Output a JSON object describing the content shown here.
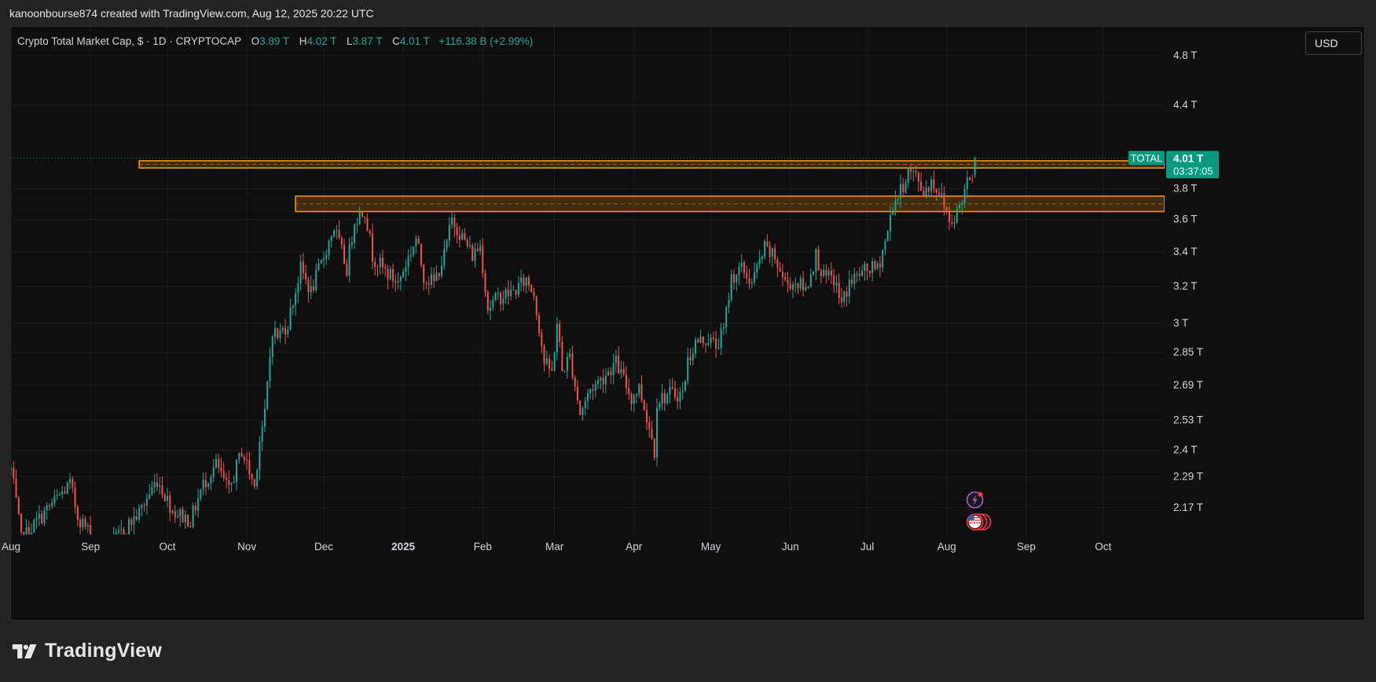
{
  "header": {
    "attribution": "kanoonbourse874 created with TradingView.com, Aug 12, 2025 20:22 UTC"
  },
  "legend": {
    "symbol": "Crypto Total Market Cap, $ · 1D · CRYPTOCAP",
    "o_key": "O",
    "o_val": "3.89 T",
    "h_key": "H",
    "h_val": "4.02 T",
    "l_key": "L",
    "l_val": "3.87 T",
    "c_key": "C",
    "c_val": "4.01 T",
    "change": "+116.38 B (+2.99%)"
  },
  "currency_button": "USD",
  "footer": {
    "brand": "TradingView"
  },
  "colors": {
    "up": "#26a69a",
    "down": "#ef5350",
    "zone": "#f7931a",
    "background": "#0f0f0f",
    "grid": "#1f1f1f",
    "price_tag": "#089981"
  },
  "chart_data": {
    "type": "candlestick",
    "series_name": "TOTAL",
    "scale": "log",
    "ylim": [
      2.07,
      5.05
    ],
    "xlim": [
      "2024-08-01",
      "2025-10-25"
    ],
    "y_ticks": [
      {
        "v": 4.8,
        "label": "4.8 T"
      },
      {
        "v": 4.4,
        "label": "4.4 T"
      },
      {
        "v": 3.8,
        "label": "3.8 T"
      },
      {
        "v": 3.6,
        "label": "3.6 T"
      },
      {
        "v": 3.4,
        "label": "3.4 T"
      },
      {
        "v": 3.2,
        "label": "3.2 T"
      },
      {
        "v": 3.0,
        "label": "3 T"
      },
      {
        "v": 2.85,
        "label": "2.85 T"
      },
      {
        "v": 2.69,
        "label": "2.69 T"
      },
      {
        "v": 2.53,
        "label": "2.53 T"
      },
      {
        "v": 2.4,
        "label": "2.4 T"
      },
      {
        "v": 2.29,
        "label": "2.29 T"
      },
      {
        "v": 2.17,
        "label": "2.17 T"
      }
    ],
    "x_ticks": [
      {
        "t": "2024-08-01",
        "label": "Aug"
      },
      {
        "t": "2024-09-01",
        "label": "Sep"
      },
      {
        "t": "2024-10-01",
        "label": "Oct"
      },
      {
        "t": "2024-11-01",
        "label": "Nov"
      },
      {
        "t": "2024-12-01",
        "label": "Dec"
      },
      {
        "t": "2025-01-01",
        "label": "2025",
        "bold": true
      },
      {
        "t": "2025-02-01",
        "label": "Feb"
      },
      {
        "t": "2025-03-01",
        "label": "Mar"
      },
      {
        "t": "2025-04-01",
        "label": "Apr"
      },
      {
        "t": "2025-05-01",
        "label": "May"
      },
      {
        "t": "2025-06-01",
        "label": "Jun"
      },
      {
        "t": "2025-07-01",
        "label": "Jul"
      },
      {
        "t": "2025-08-01",
        "label": "Aug"
      },
      {
        "t": "2025-09-01",
        "label": "Sep"
      },
      {
        "t": "2025-10-01",
        "label": "Oct"
      }
    ],
    "anchors": [
      [
        "2024-08-01",
        2.32
      ],
      [
        "2024-08-05",
        2.05
      ],
      [
        "2024-08-14",
        2.15
      ],
      [
        "2024-08-24",
        2.26
      ],
      [
        "2024-08-27",
        2.14
      ],
      [
        "2024-09-06",
        2.0
      ],
      [
        "2024-09-20",
        2.15
      ],
      [
        "2024-09-27",
        2.28
      ],
      [
        "2024-10-03",
        2.16
      ],
      [
        "2024-10-10",
        2.12
      ],
      [
        "2024-10-15",
        2.26
      ],
      [
        "2024-10-20",
        2.34
      ],
      [
        "2024-10-25",
        2.23
      ],
      [
        "2024-10-30",
        2.4
      ],
      [
        "2024-11-04",
        2.25
      ],
      [
        "2024-11-06",
        2.45
      ],
      [
        "2024-11-08",
        2.55
      ],
      [
        "2024-11-11",
        2.97
      ],
      [
        "2024-11-13",
        2.93
      ],
      [
        "2024-11-17",
        3.0
      ],
      [
        "2024-11-22",
        3.3
      ],
      [
        "2024-11-26",
        3.17
      ],
      [
        "2024-11-30",
        3.33
      ],
      [
        "2024-12-05",
        3.55
      ],
      [
        "2024-12-10",
        3.3
      ],
      [
        "2024-12-13",
        3.6
      ],
      [
        "2024-12-17",
        3.66
      ],
      [
        "2024-12-20",
        3.38
      ],
      [
        "2024-12-24",
        3.3
      ],
      [
        "2024-12-30",
        3.22
      ],
      [
        "2025-01-02",
        3.33
      ],
      [
        "2025-01-06",
        3.48
      ],
      [
        "2025-01-09",
        3.26
      ],
      [
        "2025-01-13",
        3.22
      ],
      [
        "2025-01-17",
        3.38
      ],
      [
        "2025-01-20",
        3.6
      ],
      [
        "2025-01-23",
        3.52
      ],
      [
        "2025-01-28",
        3.38
      ],
      [
        "2025-01-31",
        3.44
      ],
      [
        "2025-02-03",
        3.08
      ],
      [
        "2025-02-07",
        3.14
      ],
      [
        "2025-02-13",
        3.17
      ],
      [
        "2025-02-18",
        3.24
      ],
      [
        "2025-02-21",
        3.16
      ],
      [
        "2025-02-25",
        2.8
      ],
      [
        "2025-02-28",
        2.75
      ],
      [
        "2025-03-02",
        3.0
      ],
      [
        "2025-03-04",
        2.76
      ],
      [
        "2025-03-07",
        2.83
      ],
      [
        "2025-03-11",
        2.56
      ],
      [
        "2025-03-15",
        2.67
      ],
      [
        "2025-03-20",
        2.73
      ],
      [
        "2025-03-25",
        2.8
      ],
      [
        "2025-03-31",
        2.63
      ],
      [
        "2025-04-03",
        2.68
      ],
      [
        "2025-04-07",
        2.5
      ],
      [
        "2025-04-09",
        2.4
      ],
      [
        "2025-04-10",
        2.62
      ],
      [
        "2025-04-15",
        2.65
      ],
      [
        "2025-04-20",
        2.65
      ],
      [
        "2025-04-22",
        2.81
      ],
      [
        "2025-04-25",
        2.9
      ],
      [
        "2025-04-30",
        2.92
      ],
      [
        "2025-05-03",
        2.88
      ],
      [
        "2025-05-06",
        2.96
      ],
      [
        "2025-05-09",
        3.25
      ],
      [
        "2025-05-13",
        3.3
      ],
      [
        "2025-05-17",
        3.22
      ],
      [
        "2025-05-22",
        3.42
      ],
      [
        "2025-05-26",
        3.36
      ],
      [
        "2025-05-30",
        3.22
      ],
      [
        "2025-06-04",
        3.22
      ],
      [
        "2025-06-07",
        3.18
      ],
      [
        "2025-06-11",
        3.38
      ],
      [
        "2025-06-14",
        3.25
      ],
      [
        "2025-06-18",
        3.24
      ],
      [
        "2025-06-21",
        3.1
      ],
      [
        "2025-06-24",
        3.22
      ],
      [
        "2025-06-28",
        3.27
      ],
      [
        "2025-07-02",
        3.3
      ],
      [
        "2025-07-05",
        3.3
      ],
      [
        "2025-07-09",
        3.52
      ],
      [
        "2025-07-11",
        3.7
      ],
      [
        "2025-07-14",
        3.78
      ],
      [
        "2025-07-17",
        3.92
      ],
      [
        "2025-07-20",
        3.88
      ],
      [
        "2025-07-23",
        3.78
      ],
      [
        "2025-07-26",
        3.85
      ],
      [
        "2025-07-29",
        3.78
      ],
      [
        "2025-08-01",
        3.65
      ],
      [
        "2025-08-02",
        3.58
      ],
      [
        "2025-08-05",
        3.65
      ],
      [
        "2025-08-07",
        3.72
      ],
      [
        "2025-08-09",
        3.88
      ],
      [
        "2025-08-11",
        3.9
      ],
      [
        "2025-08-12",
        4.01
      ]
    ],
    "zones": [
      {
        "t_start": "2024-09-20",
        "y_top": 3.99,
        "y_bottom": 3.94
      },
      {
        "t_start": "2024-11-20",
        "y_top": 3.75,
        "y_bottom": 3.65
      }
    ],
    "last": {
      "label": "TOTAL",
      "value": 4.01,
      "value_text": "4.01 T",
      "countdown": "03:37:05"
    }
  }
}
